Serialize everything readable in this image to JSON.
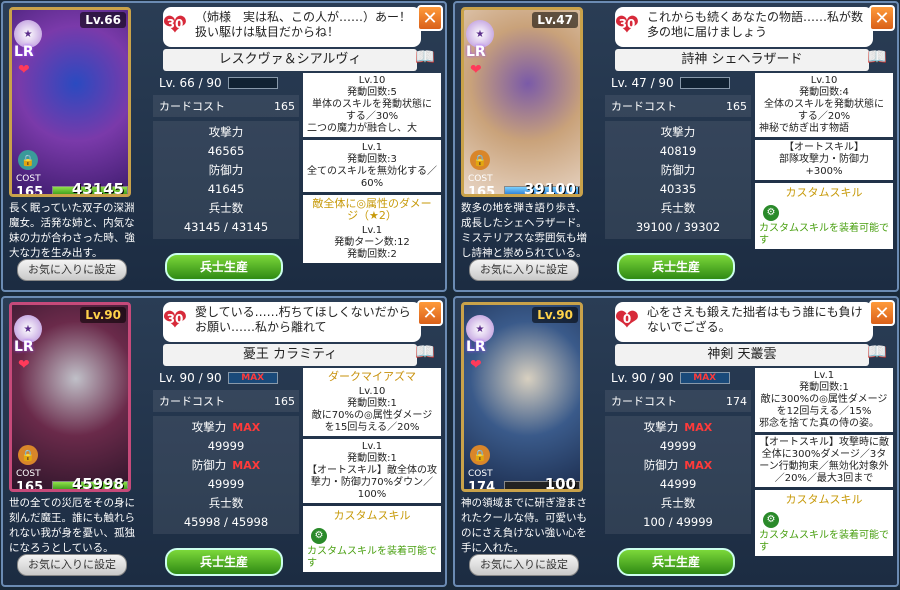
{
  "panels": [
    {
      "card": {
        "level": "Lv.66",
        "rarity": "LR",
        "cost_label": "COST",
        "cost": "165",
        "hp_value": "43145",
        "hp_fill": 1.0
      },
      "affinity": "30",
      "quote": "（姉様　実は私、この人が……）あー！ 扱い駆けは駄目だからね！",
      "name": "レスクヴァ＆シアルヴィ",
      "level_text": "Lv. 66 / 90",
      "cost_label": "カードコスト",
      "cost_value": "165",
      "attack_label": "攻撃力",
      "attack": "46565",
      "defense_label": "防御力",
      "defense": "41645",
      "troops_label": "兵士数",
      "troops": "43145 / 43145",
      "description": "長く眠っていた双子の深淵魔女。活発な姉と、内気な妹の力が合わさった時、強大な力を生み出す。",
      "fav_label": "お気に入りに設定",
      "gen_label": "兵士生産",
      "skills": [
        {
          "title": "",
          "lines": [
            "Lv.10",
            "発動回数:5",
            "単体のスキルを発動状態にする／30%",
            "二つの魔力が融合し、大"
          ]
        },
        {
          "title": "",
          "lines": [
            "Lv.1",
            "発動回数:3",
            "全てのスキルを無効化する／60%"
          ]
        },
        {
          "title": "敵全体に◎属性のダメージ（★2）",
          "lines": [
            "Lv.1",
            "発動ターン数:12",
            "発動回数:2"
          ]
        }
      ]
    },
    {
      "card": {
        "level": "Lv.47",
        "rarity": "LR",
        "cost_label": "COST",
        "cost": "165",
        "hp_value": "39100",
        "hp_fill": 0.99
      },
      "affinity": "30",
      "quote": "これからも続くあなたの物語……私が数多の地に届けましょう",
      "name": "詩神 シェヘラザード",
      "level_text": "Lv. 47 / 90",
      "cost_label": "カードコスト",
      "cost_value": "165",
      "attack_label": "攻撃力",
      "attack": "40819",
      "defense_label": "防御力",
      "defense": "40335",
      "troops_label": "兵士数",
      "troops": "39100 / 39302",
      "description": "数多の地を弾き語り歩き、成長したシェヘラザード。ミステリアスな雰囲気も増し詩神と崇められている。",
      "fav_label": "お気に入りに設定",
      "gen_label": "兵士生産",
      "skills": [
        {
          "title": "",
          "lines": [
            "Lv.10",
            "発動回数:4",
            "全体のスキルを発動状態にする／20%",
            "神秘で紡ぎ出す物語"
          ]
        },
        {
          "title": "",
          "lines": [
            "【オートスキル】",
            "部隊攻撃力・防御力 +300%"
          ]
        }
      ],
      "custom": {
        "title": "カスタムスキル",
        "text": "カスタムスキルを装着可能です"
      }
    },
    {
      "card": {
        "level": "Lv.90",
        "rarity": "LR",
        "cost_label": "COST",
        "cost": "165",
        "hp_value": "45998",
        "hp_fill": 1.0
      },
      "affinity": "30",
      "quote": "愛している……朽ちてほしくないだからお願い……私から離れて",
      "name": "憂王 カラミティ",
      "level_text": "Lv. 90 / 90",
      "max_label": "MAX",
      "cost_label": "カードコスト",
      "cost_value": "165",
      "attack_label": "攻撃力",
      "attack": "49999",
      "defense_label": "防御力",
      "defense": "49999",
      "troops_label": "兵士数",
      "troops": "45998 / 45998",
      "description": "世の全ての災厄をその身に刻んだ魔王。誰にも触れられない我が身を憂い、孤独になろうとしている。",
      "fav_label": "お気に入りに設定",
      "gen_label": "兵士生産",
      "skills": [
        {
          "title": "ダークマイアズマ",
          "lines": [
            "Lv.10",
            "発動回数:1",
            "敵に70%の◎属性ダメージを15回与える／20%"
          ]
        },
        {
          "title": "",
          "lines": [
            "Lv.1",
            "発動回数:1",
            "【オートスキル】敵全体の攻撃力・防御力70%ダウン／100%"
          ]
        }
      ],
      "custom": {
        "title": "カスタムスキル",
        "text": "カスタムスキルを装着可能です"
      }
    },
    {
      "card": {
        "level": "Lv.90",
        "rarity": "LR",
        "cost_label": "COST",
        "cost": "174",
        "hp_value": "100",
        "hp_fill": 0.002
      },
      "affinity": "0",
      "quote": "心をさえも鍛えた拙者はもう誰にも負けないでござる。",
      "name": "神剣 天叢雲",
      "level_text": "Lv. 90 / 90",
      "max_label": "MAX",
      "cost_label": "カードコスト",
      "cost_value": "174",
      "attack_label": "攻撃力",
      "attack": "49999",
      "defense_label": "防御力",
      "defense": "44999",
      "troops_label": "兵士数",
      "troops": "100 / 49999",
      "description": "神の領域までに研ぎ澄まされたクールな侍。可愛いものにさえ負けない強い心を手に入れた。",
      "fav_label": "お気に入りに設定",
      "gen_label": "兵士生産",
      "skills": [
        {
          "title": "",
          "lines": [
            "Lv.1",
            "発動回数:1",
            "敵に300%の◎属性ダメージを12回与える／15%",
            "邪念を捨てた真の侍の姿。"
          ]
        },
        {
          "title": "",
          "lines": [
            "【オートスキル】攻撃時に敵全体に300%ダメージ／3ターン行動拘束／無効化対象外／20%／最大3回まで"
          ]
        }
      ],
      "custom": {
        "title": "カスタムスキル",
        "text": "カスタムスキルを装着可能です"
      }
    }
  ]
}
